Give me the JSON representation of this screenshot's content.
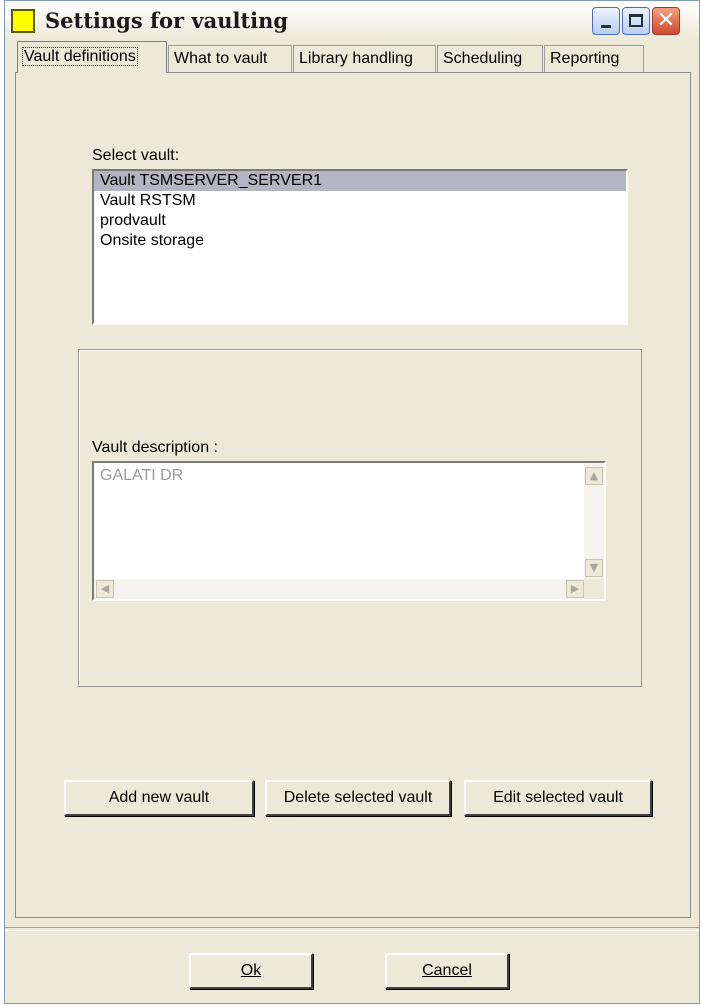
{
  "window": {
    "title": "Settings for vaulting"
  },
  "tabs": [
    "Vault definitions",
    "What to vault",
    "Library handling",
    "Scheduling",
    "Reporting"
  ],
  "vault_list": {
    "label": "Select vault:",
    "items": [
      "Vault  TSMSERVER_SERVER1",
      "Vault RSTSM",
      "prodvault",
      "Onsite storage"
    ],
    "selected": "Vault  TSMSERVER_SERVER1"
  },
  "description": {
    "label": "Vault description :",
    "value": "GALATI  DR"
  },
  "actions": {
    "add": "Add new vault",
    "delete": "Delete selected vault",
    "edit": "Edit selected vault"
  },
  "footer": {
    "ok": "Ok",
    "cancel": "Cancel"
  }
}
